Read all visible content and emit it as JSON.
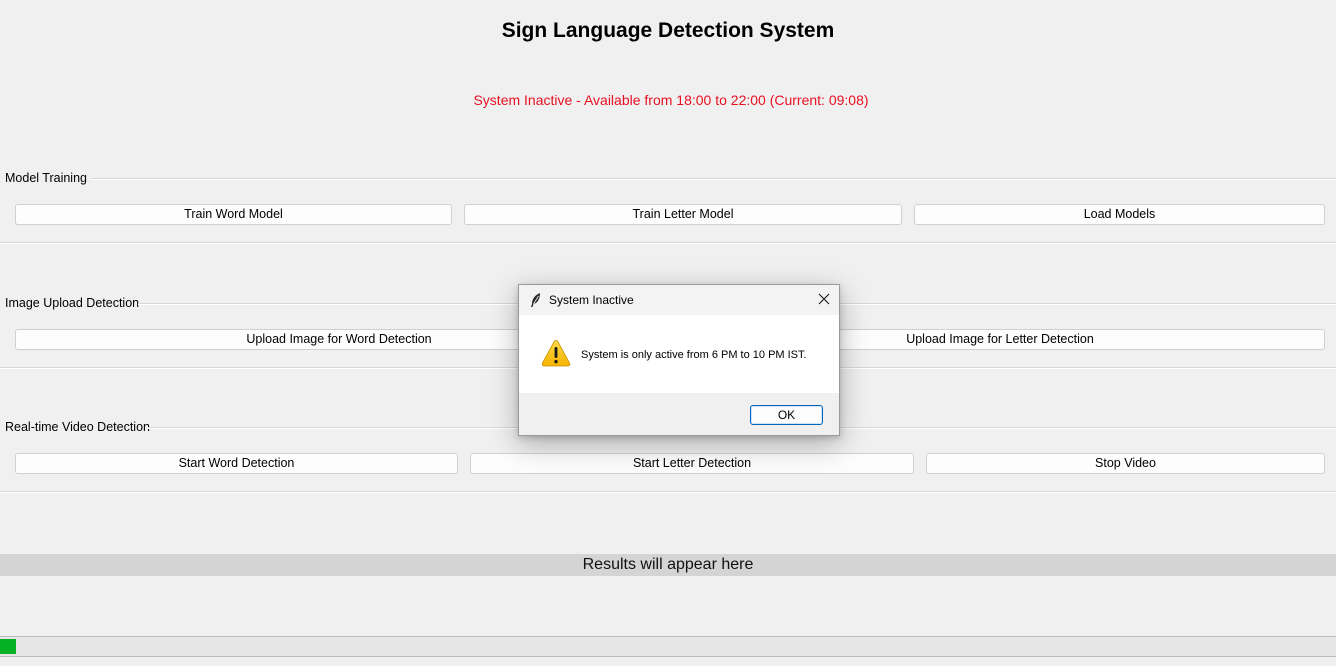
{
  "app": {
    "title": "Sign Language Detection System",
    "status_text": "System Inactive - Available from 18:00 to 22:00 (Current: 09:08)",
    "status_color": "#e81123"
  },
  "sections": {
    "model_training": {
      "label": "Model Training",
      "buttons": [
        "Train Word Model",
        "Train Letter Model",
        "Load Models"
      ]
    },
    "image_upload": {
      "label": "Image Upload Detection",
      "buttons": [
        "Upload Image for Word Detection",
        "Upload Image for Letter Detection"
      ]
    },
    "video_detection": {
      "label": "Real-time Video Detection",
      "buttons": [
        "Start Word Detection",
        "Start Letter Detection",
        "Stop Video"
      ]
    }
  },
  "results": {
    "text": "Results will appear here"
  },
  "progress": {
    "value": 0.012,
    "color": "#06b025"
  },
  "dialog": {
    "title": "System Inactive",
    "message": "System is only active from 6 PM to 10 PM IST.",
    "ok_label": "OK",
    "icon": "warning-icon",
    "app_icon": "feather-icon"
  }
}
